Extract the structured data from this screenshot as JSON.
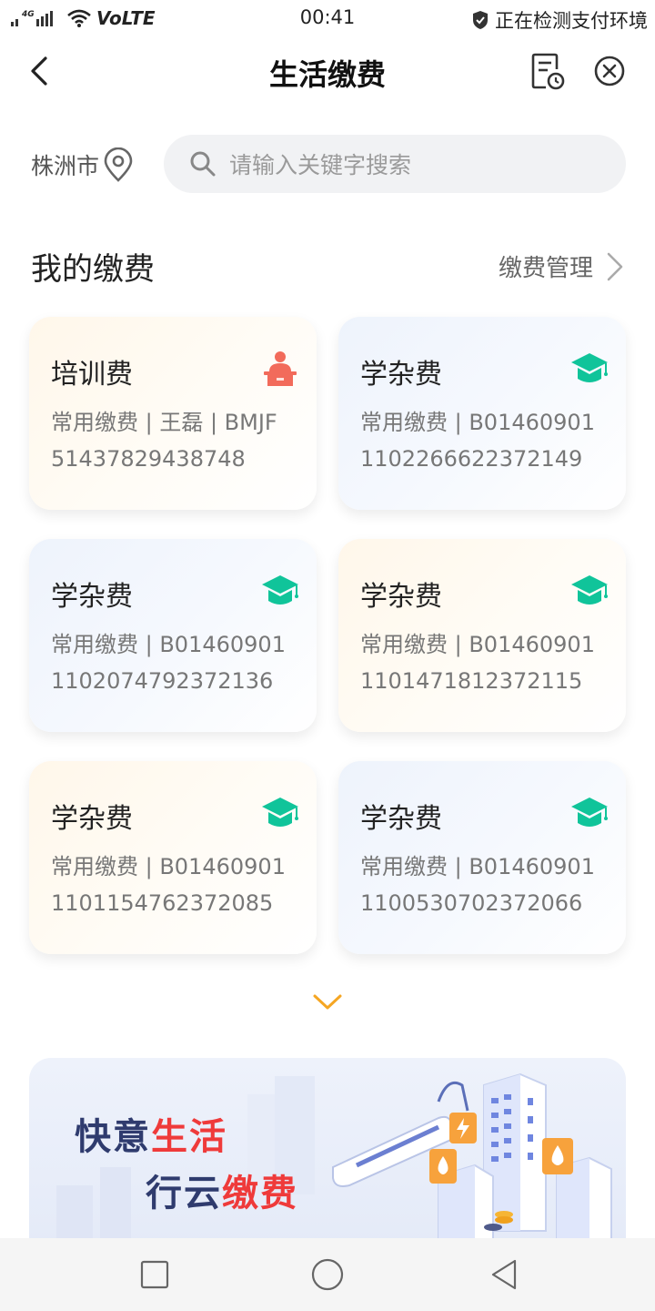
{
  "status_bar": {
    "network": "4G",
    "volte": "VoLTE",
    "time": "00:41",
    "security_text": "正在检测支付环境"
  },
  "header": {
    "title": "生活缴费"
  },
  "location": {
    "city": "株洲市"
  },
  "search": {
    "placeholder": "请输入关键字搜索"
  },
  "section": {
    "title": "我的缴费",
    "manage_label": "缴费管理"
  },
  "cards": [
    {
      "title": "培训费",
      "line1": "常用缴费 | 王磊 | BMJF",
      "line2": "51437829438748",
      "icon": "teacher-icon",
      "style": "warm"
    },
    {
      "title": "学杂费",
      "line1": "常用缴费 | B01460901",
      "line2": "1102266622372149",
      "icon": "graduation-cap-icon",
      "style": "cool"
    },
    {
      "title": "学杂费",
      "line1": "常用缴费 | B01460901",
      "line2": "1102074792372136",
      "icon": "graduation-cap-icon",
      "style": "cool"
    },
    {
      "title": "学杂费",
      "line1": "常用缴费 | B01460901",
      "line2": "1101471812372115",
      "icon": "graduation-cap-icon",
      "style": "warm"
    },
    {
      "title": "学杂费",
      "line1": "常用缴费 | B01460901",
      "line2": "1101154762372085",
      "icon": "graduation-cap-icon",
      "style": "warm"
    },
    {
      "title": "学杂费",
      "line1": "常用缴费 | B01460901",
      "line2": "1100530702372066",
      "icon": "graduation-cap-icon",
      "style": "cool"
    }
  ],
  "banner": {
    "slogan1_a": "快意",
    "slogan1_b": "生活",
    "slogan2_a": "行云",
    "slogan2_b": "缴费"
  },
  "colors": {
    "accent_green": "#10c49a",
    "accent_red": "#f26b5b",
    "arrow_orange": "#f5a623",
    "slogan_navy": "#2f3b6e",
    "slogan_red": "#ef3a3a"
  }
}
